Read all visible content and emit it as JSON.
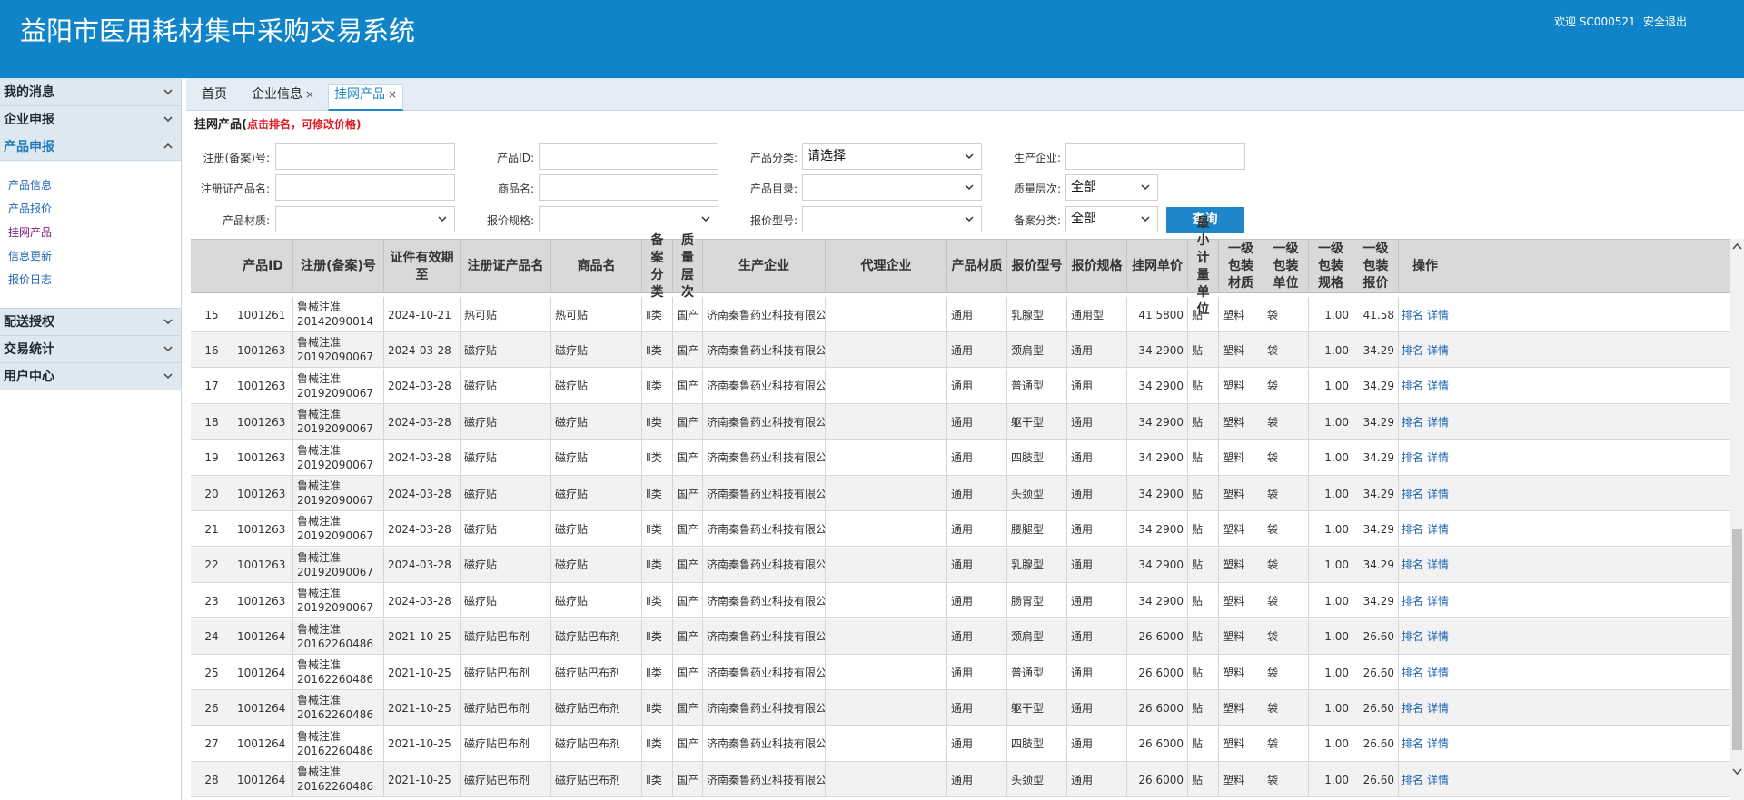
{
  "header": {
    "title": "益阳市医用耗材集中采购交易系统",
    "welcome": "欢迎 SC000521",
    "logout": "安全退出",
    "bg_color": "#0f84c8"
  },
  "sidebar": {
    "groups": [
      {
        "label": "我的消息",
        "expanded": false
      },
      {
        "label": "企业申报",
        "expanded": false
      },
      {
        "label": "产品申报",
        "expanded": true
      },
      {
        "label": "配送授权",
        "expanded": false
      },
      {
        "label": "交易统计",
        "expanded": false
      },
      {
        "label": "用户中心",
        "expanded": false
      }
    ],
    "items": [
      "产品信息",
      "产品报价",
      "挂网产品",
      "信息更新",
      "报价日志"
    ],
    "current_item": "挂网产品"
  },
  "tabs": [
    {
      "label": "首页",
      "closable": false
    },
    {
      "label": "企业信息",
      "closable": true
    },
    {
      "label": "挂网产品",
      "closable": true,
      "active": true
    }
  ],
  "tab_close_glyph": "×",
  "page": {
    "heading": "挂网产品(",
    "hint": "点击排名，可修改价格)"
  },
  "filters": {
    "reg_no": {
      "label": "注册(备案)号:",
      "value": ""
    },
    "product_id": {
      "label": "产品ID:",
      "value": ""
    },
    "category": {
      "label": "产品分类:",
      "value": "请选择"
    },
    "manufacturer": {
      "label": "生产企业:",
      "value": ""
    },
    "cert_name": {
      "label": "注册证产品名:",
      "value": ""
    },
    "trade_name": {
      "label": "商品名:",
      "value": ""
    },
    "catalog": {
      "label": "产品目录:",
      "value": ""
    },
    "quality": {
      "label": "质量层次:",
      "value": "全部"
    },
    "material": {
      "label": "产品材质:",
      "value": ""
    },
    "quote_spec": {
      "label": "报价规格:",
      "value": ""
    },
    "quote_model": {
      "label": "报价型号:",
      "value": ""
    },
    "record_type": {
      "label": "备案分类:",
      "value": "全部"
    },
    "query_button": "查询"
  },
  "table": {
    "columns": [
      "",
      "产品ID",
      "注册(备案)号",
      "证件有效期至",
      "注册证产品名",
      "商品名",
      "备案分类",
      "质量层次",
      "生产企业",
      "代理企业",
      "产品材质",
      "报价型号",
      "报价规格",
      "挂网单价",
      "最小计量单位",
      "一级包装材质",
      "一级包装单位",
      "一级包装规格",
      "一级包装报价",
      "操作"
    ],
    "op_rank": "排名",
    "op_detail": "详情",
    "rows": [
      {
        "no": "15",
        "id": "1001261",
        "reg1": "鲁械注准",
        "reg2": "20142090014",
        "valid": "2024-10-21",
        "cert": "热可贴",
        "trade": "热可贴",
        "cls": "Ⅱ类",
        "quality": "国产",
        "mfr": "济南秦鲁药业科技有限公司",
        "agent": "",
        "material": "通用",
        "model": "乳腺型",
        "spec": "通用型",
        "price": "41.5800",
        "unit": "贴",
        "pkg_mat": "塑料",
        "pkg_unit": "袋",
        "pkg_spec": "1.00",
        "pkg_price": "41.58"
      },
      {
        "no": "16",
        "id": "1001263",
        "reg1": "鲁械注准",
        "reg2": "20192090067",
        "valid": "2024-03-28",
        "cert": "磁疗贴",
        "trade": "磁疗贴",
        "cls": "Ⅱ类",
        "quality": "国产",
        "mfr": "济南秦鲁药业科技有限公司",
        "agent": "",
        "material": "通用",
        "model": "颈肩型",
        "spec": "通用",
        "price": "34.2900",
        "unit": "贴",
        "pkg_mat": "塑料",
        "pkg_unit": "袋",
        "pkg_spec": "1.00",
        "pkg_price": "34.29"
      },
      {
        "no": "17",
        "id": "1001263",
        "reg1": "鲁械注准",
        "reg2": "20192090067",
        "valid": "2024-03-28",
        "cert": "磁疗贴",
        "trade": "磁疗贴",
        "cls": "Ⅱ类",
        "quality": "国产",
        "mfr": "济南秦鲁药业科技有限公司",
        "agent": "",
        "material": "通用",
        "model": "普通型",
        "spec": "通用",
        "price": "34.2900",
        "unit": "贴",
        "pkg_mat": "塑料",
        "pkg_unit": "袋",
        "pkg_spec": "1.00",
        "pkg_price": "34.29"
      },
      {
        "no": "18",
        "id": "1001263",
        "reg1": "鲁械注准",
        "reg2": "20192090067",
        "valid": "2024-03-28",
        "cert": "磁疗贴",
        "trade": "磁疗贴",
        "cls": "Ⅱ类",
        "quality": "国产",
        "mfr": "济南秦鲁药业科技有限公司",
        "agent": "",
        "material": "通用",
        "model": "躯干型",
        "spec": "通用",
        "price": "34.2900",
        "unit": "贴",
        "pkg_mat": "塑料",
        "pkg_unit": "袋",
        "pkg_spec": "1.00",
        "pkg_price": "34.29"
      },
      {
        "no": "19",
        "id": "1001263",
        "reg1": "鲁械注准",
        "reg2": "20192090067",
        "valid": "2024-03-28",
        "cert": "磁疗贴",
        "trade": "磁疗贴",
        "cls": "Ⅱ类",
        "quality": "国产",
        "mfr": "济南秦鲁药业科技有限公司",
        "agent": "",
        "material": "通用",
        "model": "四肢型",
        "spec": "通用",
        "price": "34.2900",
        "unit": "贴",
        "pkg_mat": "塑料",
        "pkg_unit": "袋",
        "pkg_spec": "1.00",
        "pkg_price": "34.29"
      },
      {
        "no": "20",
        "id": "1001263",
        "reg1": "鲁械注准",
        "reg2": "20192090067",
        "valid": "2024-03-28",
        "cert": "磁疗贴",
        "trade": "磁疗贴",
        "cls": "Ⅱ类",
        "quality": "国产",
        "mfr": "济南秦鲁药业科技有限公司",
        "agent": "",
        "material": "通用",
        "model": "头颈型",
        "spec": "通用",
        "price": "34.2900",
        "unit": "贴",
        "pkg_mat": "塑料",
        "pkg_unit": "袋",
        "pkg_spec": "1.00",
        "pkg_price": "34.29"
      },
      {
        "no": "21",
        "id": "1001263",
        "reg1": "鲁械注准",
        "reg2": "20192090067",
        "valid": "2024-03-28",
        "cert": "磁疗贴",
        "trade": "磁疗贴",
        "cls": "Ⅱ类",
        "quality": "国产",
        "mfr": "济南秦鲁药业科技有限公司",
        "agent": "",
        "material": "通用",
        "model": "腰腿型",
        "spec": "通用",
        "price": "34.2900",
        "unit": "贴",
        "pkg_mat": "塑料",
        "pkg_unit": "袋",
        "pkg_spec": "1.00",
        "pkg_price": "34.29"
      },
      {
        "no": "22",
        "id": "1001263",
        "reg1": "鲁械注准",
        "reg2": "20192090067",
        "valid": "2024-03-28",
        "cert": "磁疗贴",
        "trade": "磁疗贴",
        "cls": "Ⅱ类",
        "quality": "国产",
        "mfr": "济南秦鲁药业科技有限公司",
        "agent": "",
        "material": "通用",
        "model": "乳腺型",
        "spec": "通用",
        "price": "34.2900",
        "unit": "贴",
        "pkg_mat": "塑料",
        "pkg_unit": "袋",
        "pkg_spec": "1.00",
        "pkg_price": "34.29"
      },
      {
        "no": "23",
        "id": "1001263",
        "reg1": "鲁械注准",
        "reg2": "20192090067",
        "valid": "2024-03-28",
        "cert": "磁疗贴",
        "trade": "磁疗贴",
        "cls": "Ⅱ类",
        "quality": "国产",
        "mfr": "济南秦鲁药业科技有限公司",
        "agent": "",
        "material": "通用",
        "model": "肠胃型",
        "spec": "通用",
        "price": "34.2900",
        "unit": "贴",
        "pkg_mat": "塑料",
        "pkg_unit": "袋",
        "pkg_spec": "1.00",
        "pkg_price": "34.29"
      },
      {
        "no": "24",
        "id": "1001264",
        "reg1": "鲁械注准",
        "reg2": "20162260486",
        "valid": "2021-10-25",
        "cert": "磁疗贴巴布剂",
        "trade": "磁疗贴巴布剂",
        "cls": "Ⅱ类",
        "quality": "国产",
        "mfr": "济南秦鲁药业科技有限公司",
        "agent": "",
        "material": "通用",
        "model": "颈肩型",
        "spec": "通用",
        "price": "26.6000",
        "unit": "贴",
        "pkg_mat": "塑料",
        "pkg_unit": "袋",
        "pkg_spec": "1.00",
        "pkg_price": "26.60"
      },
      {
        "no": "25",
        "id": "1001264",
        "reg1": "鲁械注准",
        "reg2": "20162260486",
        "valid": "2021-10-25",
        "cert": "磁疗贴巴布剂",
        "trade": "磁疗贴巴布剂",
        "cls": "Ⅱ类",
        "quality": "国产",
        "mfr": "济南秦鲁药业科技有限公司",
        "agent": "",
        "material": "通用",
        "model": "普通型",
        "spec": "通用",
        "price": "26.6000",
        "unit": "贴",
        "pkg_mat": "塑料",
        "pkg_unit": "袋",
        "pkg_spec": "1.00",
        "pkg_price": "26.60"
      },
      {
        "no": "26",
        "id": "1001264",
        "reg1": "鲁械注准",
        "reg2": "20162260486",
        "valid": "2021-10-25",
        "cert": "磁疗贴巴布剂",
        "trade": "磁疗贴巴布剂",
        "cls": "Ⅱ类",
        "quality": "国产",
        "mfr": "济南秦鲁药业科技有限公司",
        "agent": "",
        "material": "通用",
        "model": "躯干型",
        "spec": "通用",
        "price": "26.6000",
        "unit": "贴",
        "pkg_mat": "塑料",
        "pkg_unit": "袋",
        "pkg_spec": "1.00",
        "pkg_price": "26.60"
      },
      {
        "no": "27",
        "id": "1001264",
        "reg1": "鲁械注准",
        "reg2": "20162260486",
        "valid": "2021-10-25",
        "cert": "磁疗贴巴布剂",
        "trade": "磁疗贴巴布剂",
        "cls": "Ⅱ类",
        "quality": "国产",
        "mfr": "济南秦鲁药业科技有限公司",
        "agent": "",
        "material": "通用",
        "model": "四肢型",
        "spec": "通用",
        "price": "26.6000",
        "unit": "贴",
        "pkg_mat": "塑料",
        "pkg_unit": "袋",
        "pkg_spec": "1.00",
        "pkg_price": "26.60"
      },
      {
        "no": "28",
        "id": "1001264",
        "reg1": "鲁械注准",
        "reg2": "20162260486",
        "valid": "2021-10-25",
        "cert": "磁疗贴巴布剂",
        "trade": "磁疗贴巴布剂",
        "cls": "Ⅱ类",
        "quality": "国产",
        "mfr": "济南秦鲁药业科技有限公司",
        "agent": "",
        "material": "通用",
        "model": "头颈型",
        "spec": "通用",
        "price": "26.6000",
        "unit": "贴",
        "pkg_mat": "塑料",
        "pkg_unit": "袋",
        "pkg_spec": "1.00",
        "pkg_price": "26.60"
      }
    ]
  },
  "icons": {
    "collapse": "chevron-down-icon",
    "expand": "chevron-up-icon",
    "select": "dropdown-arrow-icon",
    "close": "close-icon"
  }
}
